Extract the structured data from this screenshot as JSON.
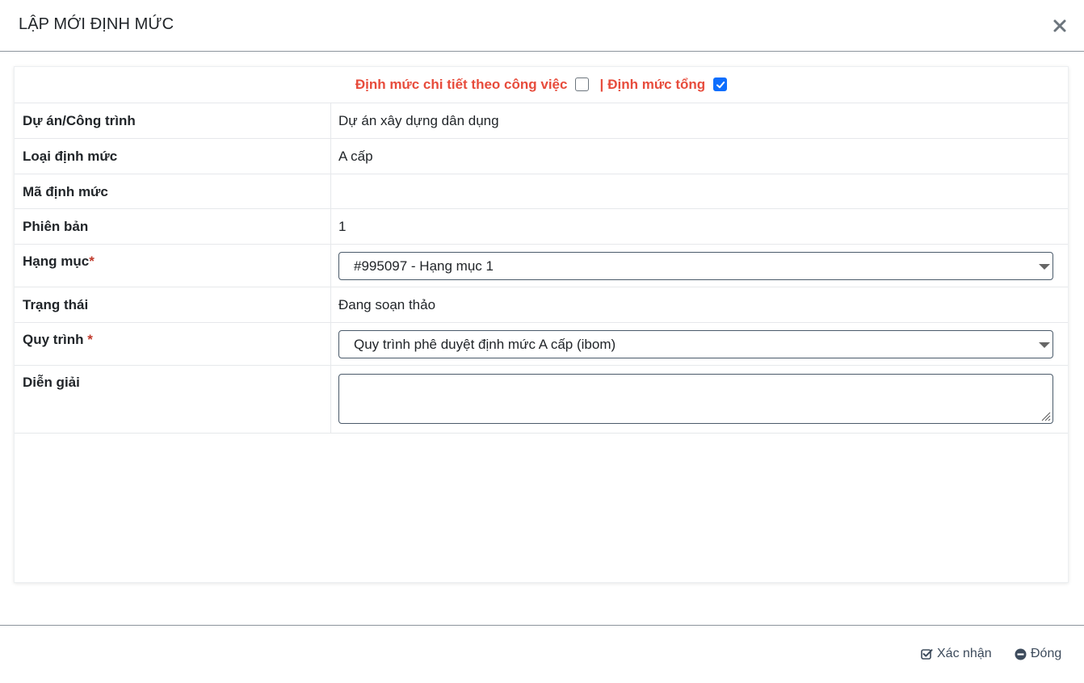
{
  "dialog": {
    "title": "LẬP MỚI ĐỊNH MỨC",
    "close_icon": "close-icon"
  },
  "mode": {
    "detail_label": "Định mức chi tiết theo công việc",
    "detail_checked": false,
    "separator": "|",
    "total_label": "Định mức tổng",
    "total_checked": true
  },
  "form": {
    "project": {
      "label": "Dự án/Công trình",
      "value": "Dự án xây dựng dân dụng"
    },
    "norm_type": {
      "label": "Loại định mức",
      "value": "A cấp"
    },
    "norm_code": {
      "label": "Mã định mức",
      "value": ""
    },
    "version": {
      "label": "Phiên bản",
      "value": "1"
    },
    "category": {
      "label": "Hạng mục",
      "required_mark": "*",
      "selected": "#995097 - Hạng mục 1"
    },
    "status": {
      "label": "Trạng thái",
      "value": "Đang soạn thảo"
    },
    "workflow": {
      "label": "Quy trình",
      "required_mark": "*",
      "selected": "Quy trình phê duyệt định mức A cấp (ibom)"
    },
    "description": {
      "label": "Diễn giải",
      "value": ""
    }
  },
  "footer": {
    "confirm_label": "Xác nhận",
    "confirm_icon": "check-square-icon",
    "close_label": "Đóng",
    "close_icon": "minus-circle-icon"
  },
  "colors": {
    "mode_text": "#e74c3c",
    "required": "#c0392b",
    "checkbox_checked": "#0d6efd",
    "footer_text": "#3d4b5c"
  }
}
